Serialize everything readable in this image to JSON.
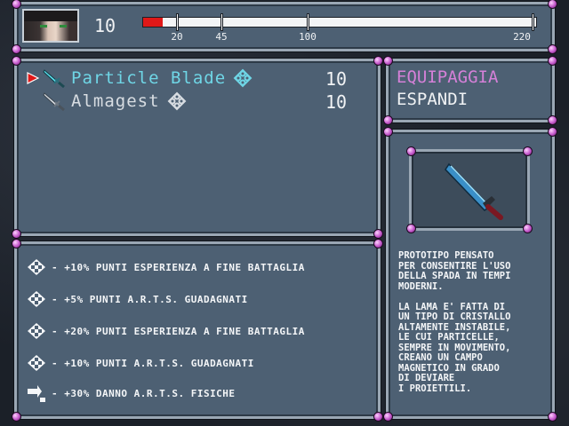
{
  "character": {
    "level": "10",
    "exp_fraction": 0.05
  },
  "gauge": {
    "ticks": [
      "20",
      "45",
      "100",
      "220"
    ]
  },
  "items": [
    {
      "name": "Particle Blade",
      "qty": "10",
      "selected": true,
      "color": "#6fd6e6",
      "icon": "sword-icon"
    },
    {
      "name": "Almagest",
      "qty": "10",
      "selected": false,
      "color": "#d8dde2",
      "icon": "sword-icon"
    }
  ],
  "menu": {
    "equip": "EQUIPAGGIA",
    "expand": "ESPANDI",
    "equip_color": "#d580d8"
  },
  "effects": [
    {
      "icon": "arts-gem-icon",
      "text": "- +10% PUNTI ESPERIENZA A FINE BATTAGLIA"
    },
    {
      "icon": "arts-gem-icon",
      "text": "- +5% PUNTI A.R.T.S. GUADAGNATI"
    },
    {
      "icon": "arts-gem-icon",
      "text": "- +20% PUNTI ESPERIENZA A FINE BATTAGLIA"
    },
    {
      "icon": "arts-gem-icon",
      "text": "- +10% PUNTI A.R.T.S. GUADAGNATI"
    },
    {
      "icon": "arts-sword-icon",
      "text": "- +30% DANNO A.R.T.S. FISICHE"
    }
  ],
  "description": "PROTOTIPO PENSATO\nPER CONSENTIRE L'USO\nDELLA SPADA IN TEMPI\nMODERNI.\n\nLA LAMA E' FATTA DI\nUN TIPO DI CRISTALLO\nALTAMENTE INSTABILE,\nLE CUI PARTICELLE,\nSEMPRE IN MOVIMENTO,\nCREANO UN CAMPO\nMAGNETICO IN GRADO\nDI DEVIARE\nI PROIETTILI."
}
